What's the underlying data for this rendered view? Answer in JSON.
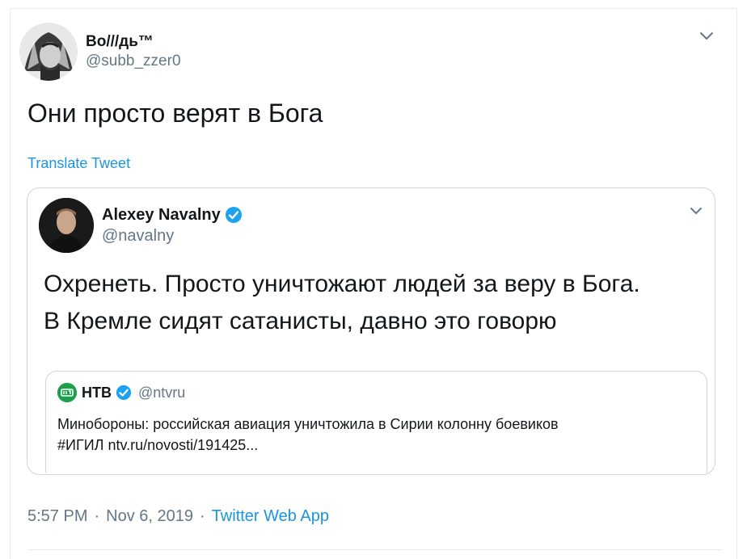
{
  "tweet": {
    "display_name": "Во///дь™",
    "handle": "@subb_zzer0",
    "text": "Они просто верят в Бога",
    "translate_label": "Translate Tweet",
    "time": "5:57 PM",
    "date": "Nov 6, 2019",
    "separator": "·",
    "source": "Twitter Web App"
  },
  "quoted": {
    "display_name": "Alexey Navalny",
    "handle": "@navalny",
    "text_line1": "Охренеть. Просто уничтожают людей за веру в Бога.",
    "text_line2": "В Кремле сидят сатанисты, давно это говорю",
    "inner": {
      "display_name": "НТВ",
      "handle": "@ntvru",
      "text_line1": "Минобороны: российская авиация уничтожила в Сирии колонну боевиков",
      "text_line2": "#ИГИЛ ntv.ru/novosti/191425..."
    }
  },
  "colors": {
    "link": "#1b95e0",
    "secondary_text": "#657786",
    "verified_badge": "#1da1f2",
    "ntv_logo": "#1d9f4c"
  },
  "icons": [
    "chevron-down-icon",
    "verified-badge-icon",
    "ntv-logo-icon"
  ]
}
